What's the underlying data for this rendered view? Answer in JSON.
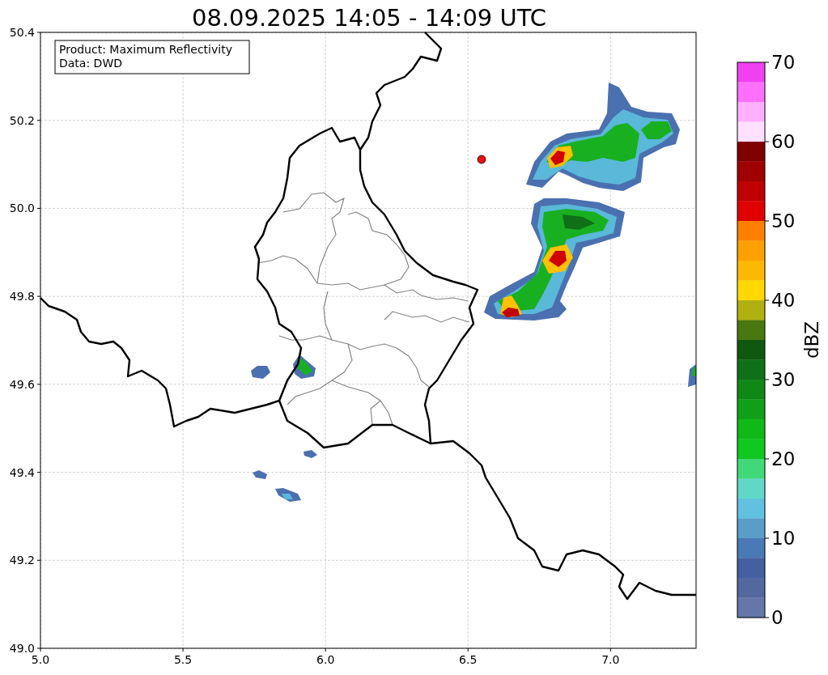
{
  "title": "08.09.2025 14:05 - 14:09 UTC",
  "info_box": {
    "lines": [
      "Product: Maximum Reflectivity",
      "Data: DWD"
    ]
  },
  "x_ticks": [
    "5.0",
    "5.5",
    "6.0",
    "6.5",
    "7.0"
  ],
  "y_ticks": [
    "50.4",
    "50.2",
    "50.0",
    "49.8",
    "49.6",
    "49.4",
    "49.2",
    "49.0"
  ],
  "colorbar": {
    "label": "dBZ",
    "ticks": [
      "70",
      "60",
      "50",
      "40",
      "30",
      "20",
      "10",
      "0"
    ],
    "bands": [
      {
        "color": "#f040f0"
      },
      {
        "color": "#ff70ff"
      },
      {
        "color": "#ffb0ff"
      },
      {
        "color": "#ffe0ff"
      },
      {
        "color": "#800000"
      },
      {
        "color": "#a00000"
      },
      {
        "color": "#c00000"
      },
      {
        "color": "#e00000"
      },
      {
        "color": "#ff8000"
      },
      {
        "color": "#ffa000"
      },
      {
        "color": "#ffb800"
      },
      {
        "color": "#ffd800"
      },
      {
        "color": "#b0b010"
      },
      {
        "color": "#4a7810"
      },
      {
        "color": "#105810"
      },
      {
        "color": "#107018"
      },
      {
        "color": "#108818"
      },
      {
        "color": "#10a018"
      },
      {
        "color": "#10b818"
      },
      {
        "color": "#10c820"
      },
      {
        "color": "#40d878"
      },
      {
        "color": "#60d8c8"
      },
      {
        "color": "#62c0e0"
      },
      {
        "color": "#5a9ec8"
      },
      {
        "color": "#4a7ab5"
      },
      {
        "color": "#4560a0"
      },
      {
        "color": "#5468a0"
      },
      {
        "color": "#6577a8"
      }
    ]
  }
}
